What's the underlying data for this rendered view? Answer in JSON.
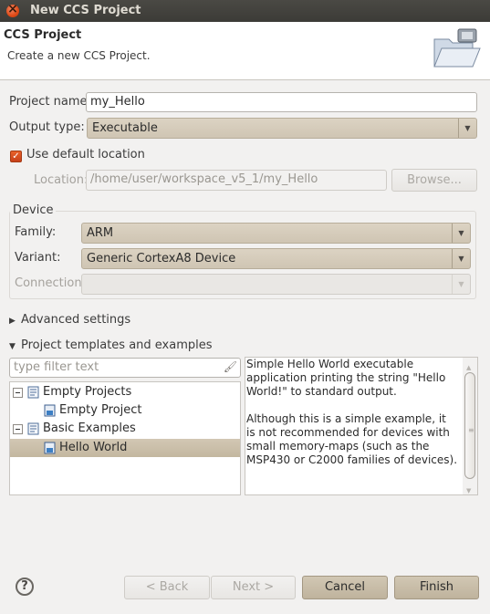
{
  "window": {
    "title": "New CCS Project"
  },
  "header": {
    "title": "CCS Project",
    "subtitle": "Create a new CCS Project."
  },
  "form": {
    "project_name_label": "Project name:",
    "project_name_value": "my_Hello",
    "output_type_label": "Output type:",
    "output_type_value": "Executable",
    "use_default_location_label": "Use default location",
    "use_default_location_checked": true,
    "location_label": "Location:",
    "location_value": "/home/user/workspace_v5_1/my_Hello",
    "browse_label": "Browse..."
  },
  "device": {
    "group_title": "Device",
    "family_label": "Family:",
    "family_value": "ARM",
    "variant_label": "Variant:",
    "variant_value": "Generic CortexA8 Device",
    "connection_label": "Connection:",
    "connection_value": ""
  },
  "advanced": {
    "label": "Advanced settings"
  },
  "templates": {
    "label": "Project templates and examples",
    "filter_placeholder": "type filter text",
    "tree": [
      {
        "label": "Empty Projects",
        "type": "folder",
        "expanded": true
      },
      {
        "label": "Empty Project",
        "type": "item"
      },
      {
        "label": "Basic Examples",
        "type": "folder",
        "expanded": true
      },
      {
        "label": "Hello World",
        "type": "item",
        "selected": true
      }
    ],
    "description_p1": "Simple Hello World executable application printing the string \"Hello World!\" to standard output.",
    "description_p2": "Although this is a simple example, it is not recommended for devices with small memory-maps (such as the MSP430 or C2000 families of devices)."
  },
  "buttons": {
    "help": "?",
    "back": "< Back",
    "next": "Next >",
    "cancel": "Cancel",
    "finish": "Finish"
  },
  "icons": {
    "close": "close-icon",
    "header": "folder-wizard-icon",
    "filter_clear": "clear-filter-icon",
    "tree_folder": "template-folder-icon",
    "tree_item": "project-template-icon"
  },
  "colors": {
    "accent": "#df4a16",
    "selection": "#c9bda8",
    "titlebar": "#3c3b37"
  }
}
